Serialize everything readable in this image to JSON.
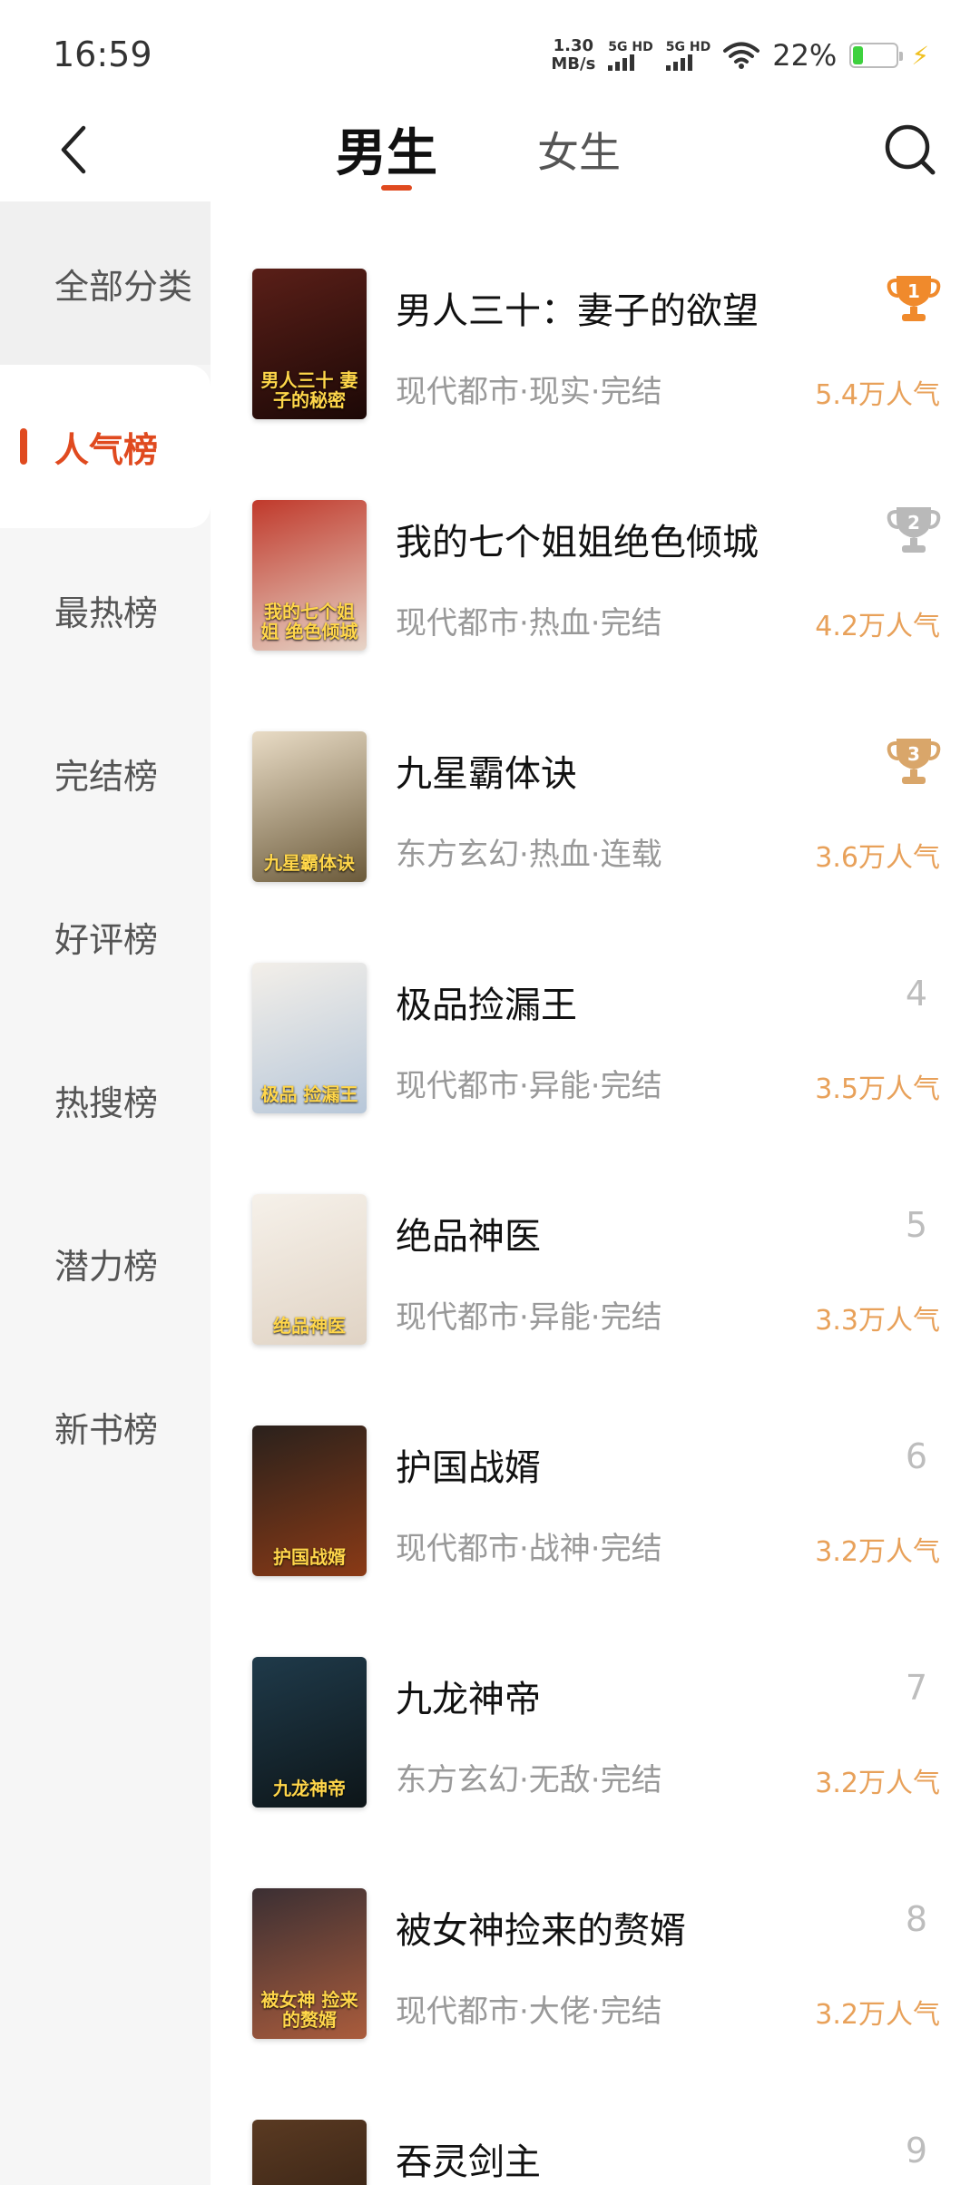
{
  "status_bar": {
    "time": "16:59",
    "net_speed_value": "1.30",
    "net_speed_unit": "MB/s",
    "sim1_label": "5G HD",
    "sim2_label": "5G HD",
    "battery_percent": "22%",
    "battery_level": 0.22
  },
  "header": {
    "tab_male": "男生",
    "tab_female": "女生",
    "active_tab": "男生",
    "accent_color": "#e04a1f"
  },
  "sidebar": {
    "items": [
      {
        "label": "全部分类"
      },
      {
        "label": "人气榜"
      },
      {
        "label": "最热榜"
      },
      {
        "label": "完结榜"
      },
      {
        "label": "好评榜"
      },
      {
        "label": "热搜榜"
      },
      {
        "label": "潜力榜"
      },
      {
        "label": "新书榜"
      }
    ],
    "active_index": 1
  },
  "books": [
    {
      "rank": "1",
      "title": "男人三十：妻子的欲望",
      "meta": "现代都市·现实·完结",
      "popularity": "5.4万人气",
      "cover_text": "男人三十 妻子的秘密",
      "cover_colors": [
        "#5a1f18",
        "#1c0806"
      ],
      "trophy": "gold"
    },
    {
      "rank": "2",
      "title": "我的七个姐姐绝色倾城",
      "meta": "现代都市·热血·完结",
      "popularity": "4.2万人气",
      "cover_text": "我的七个姐姐 绝色倾城",
      "cover_colors": [
        "#c0392b",
        "#e7d5c8"
      ],
      "trophy": "silver"
    },
    {
      "rank": "3",
      "title": "九星霸体诀",
      "meta": "东方玄幻·热血·连载",
      "popularity": "3.6万人气",
      "cover_text": "九星霸体诀",
      "cover_colors": [
        "#e9dcc6",
        "#6b5a3a"
      ],
      "trophy": "bronze"
    },
    {
      "rank": "4",
      "title": "极品捡漏王",
      "meta": "现代都市·异能·完结",
      "popularity": "3.5万人气",
      "cover_text": "极品 捡漏王",
      "cover_colors": [
        "#f3efe9",
        "#b7c7d9"
      ],
      "trophy": ""
    },
    {
      "rank": "5",
      "title": "绝品神医",
      "meta": "现代都市·异能·完结",
      "popularity": "3.3万人气",
      "cover_text": "绝品神医",
      "cover_colors": [
        "#f6f1ea",
        "#e0d3c4"
      ],
      "trophy": ""
    },
    {
      "rank": "6",
      "title": "护国战婿",
      "meta": "现代都市·战神·完结",
      "popularity": "3.2万人气",
      "cover_text": "护国战婿",
      "cover_colors": [
        "#2a211c",
        "#8a3a16"
      ],
      "trophy": ""
    },
    {
      "rank": "7",
      "title": "九龙神帝",
      "meta": "东方玄幻·无敌·完结",
      "popularity": "3.2万人气",
      "cover_text": "九龙神帝",
      "cover_colors": [
        "#1f3a4a",
        "#0d1518"
      ],
      "trophy": ""
    },
    {
      "rank": "8",
      "title": "被女神捡来的赘婿",
      "meta": "现代都市·大佬·完结",
      "popularity": "3.2万人气",
      "cover_text": "被女神 捡来的赘婿",
      "cover_colors": [
        "#3b2f33",
        "#aa5c3c"
      ],
      "trophy": ""
    },
    {
      "rank": "9",
      "title": "吞灵剑主",
      "meta": "",
      "popularity": "",
      "cover_text": "",
      "cover_colors": [
        "#5a3a22",
        "#2a1a10"
      ],
      "trophy": ""
    }
  ]
}
